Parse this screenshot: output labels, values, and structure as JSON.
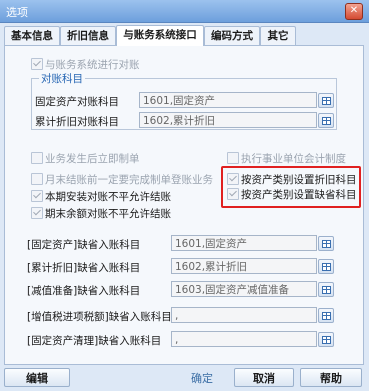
{
  "window": {
    "title": "选项",
    "close_glyph": "✕"
  },
  "tabs": [
    {
      "label": "基本信息"
    },
    {
      "label": "折旧信息"
    },
    {
      "label": "与账务系统接口"
    },
    {
      "label": "编码方式"
    },
    {
      "label": "其它"
    }
  ],
  "gl_interface": {
    "reconcile_label": "与账务系统进行对账",
    "reconcile_checked": true,
    "group_title": "对账科目",
    "asset_account_label": "固定资产对账科目",
    "asset_account_value": "1601,固定资产",
    "depr_account_label": "累计折旧对账科目",
    "depr_account_value": "1602,累计折旧"
  },
  "options": {
    "post_after_business": "业务发生后立即制单",
    "month_end_voucher": "月末结账前一定要完成制单登账业务",
    "period_imbalance": "本期安装对账不平允许结账",
    "period_end_imbalance": "期末余额对账不平允许结账",
    "public_accounting": "执行事业单位会计制度",
    "by_category_depr": "按资产类别设置折旧科目",
    "by_category_default": "按资产类别设置缺省科目"
  },
  "defaults": [
    {
      "label": "[固定资产]缺省入账科目",
      "value": "1601,固定资产"
    },
    {
      "label": "[累计折旧]缺省入账科目",
      "value": "1602,累计折旧"
    },
    {
      "label": "[减值准备]缺省入账科目",
      "value": "1603,固定资产减值准备"
    },
    {
      "label": "[增值税进项税额]缺省入账科目",
      "value": ","
    },
    {
      "label": "[固定资产清理]缺省入账科目",
      "value": ","
    }
  ],
  "buttons": {
    "edit": "编辑",
    "ok": "确定",
    "cancel": "取消",
    "help": "帮助"
  }
}
